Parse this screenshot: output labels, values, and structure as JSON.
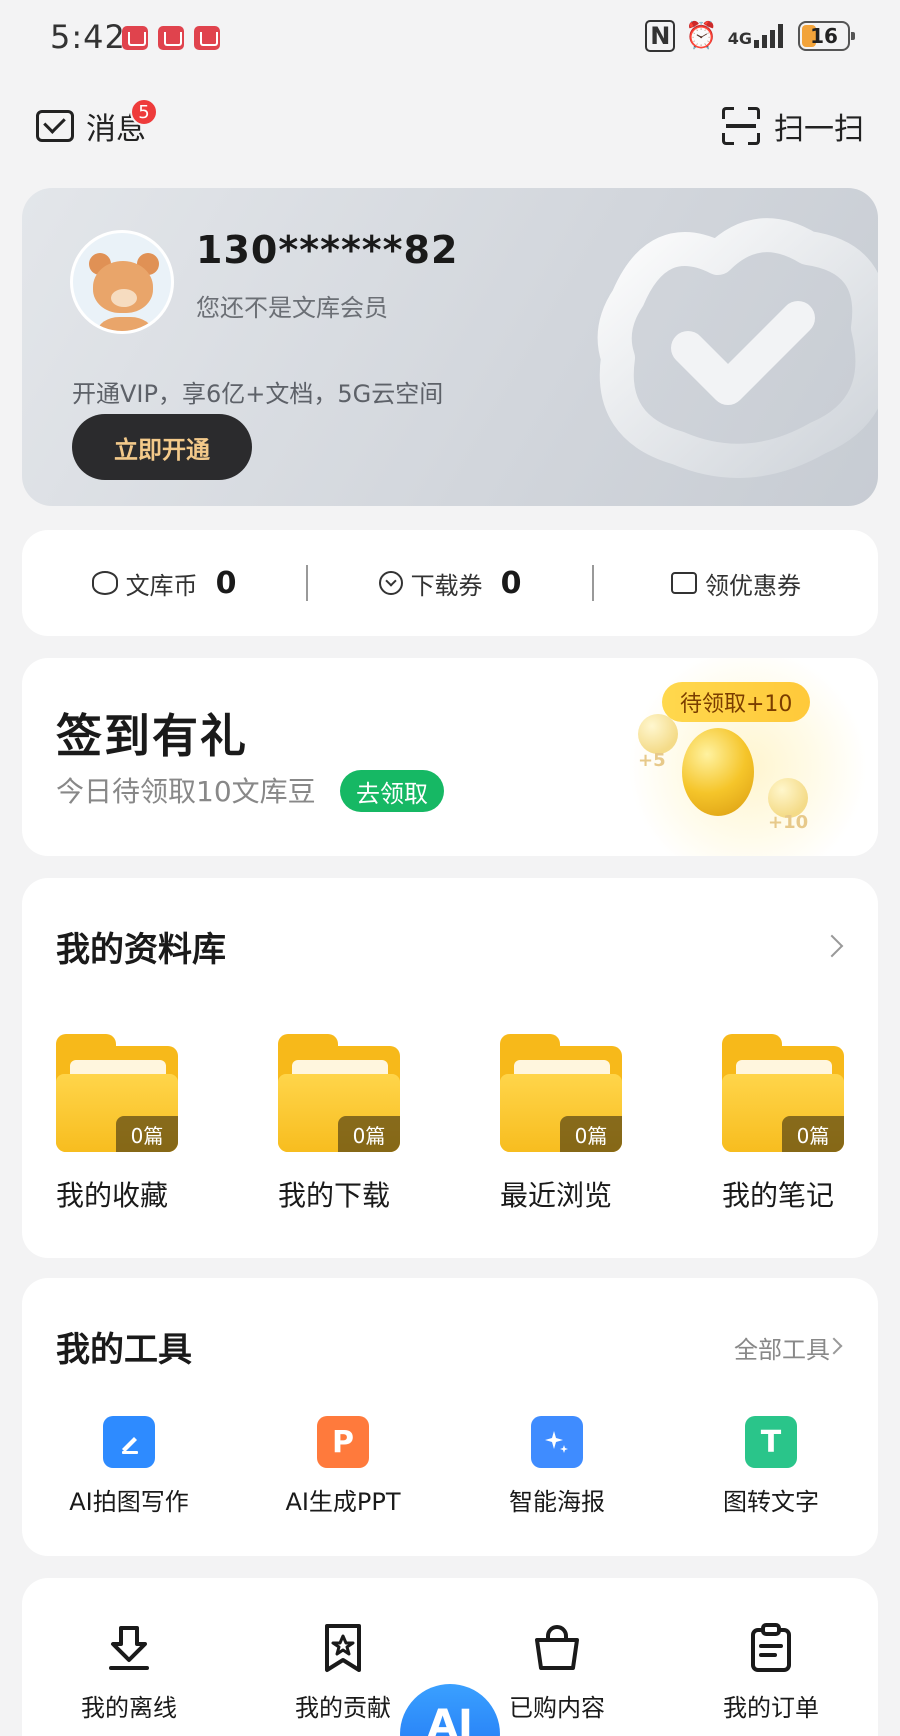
{
  "status_bar": {
    "time": "5:42",
    "network": "4G",
    "battery": "16"
  },
  "header": {
    "messages_label": "消息",
    "messages_badge": "5",
    "scan_label": "扫一扫"
  },
  "profile": {
    "username": "130******82",
    "member_status": "您还不是文库会员",
    "vip_promo": "开通VIP，享6亿+文档，5G云空间",
    "open_button": "立即开通"
  },
  "stats": {
    "coins_label": "文库币",
    "coins_value": "0",
    "tickets_label": "下载券",
    "tickets_value": "0",
    "coupon_label": "领优惠券"
  },
  "signin": {
    "title": "签到有礼",
    "subtitle": "今日待领取10文库豆",
    "claim_button": "去领取",
    "pending_label": "待领取+10",
    "bonus_small": "+5",
    "bonus_large": "+10"
  },
  "library": {
    "title": "我的资料库",
    "folders": [
      {
        "label": "我的收藏",
        "count": "0篇"
      },
      {
        "label": "我的下载",
        "count": "0篇"
      },
      {
        "label": "最近浏览",
        "count": "0篇"
      },
      {
        "label": "我的笔记",
        "count": "0篇"
      }
    ]
  },
  "tools": {
    "title": "我的工具",
    "all_tools_label": "全部工具",
    "items": [
      {
        "label": "AI拍图写作",
        "icon": "photo-write-icon",
        "color": "#2e8bff"
      },
      {
        "label": "AI生成PPT",
        "icon": "ppt-icon",
        "color": "#ff7a3c"
      },
      {
        "label": "智能海报",
        "icon": "poster-icon",
        "color": "#3f8cff"
      },
      {
        "label": "图转文字",
        "icon": "image-to-text-icon",
        "color": "#2ac58a"
      }
    ]
  },
  "bottom": {
    "items": [
      {
        "label": "我的离线",
        "icon": "offline-download-icon"
      },
      {
        "label": "我的贡献",
        "icon": "contribution-icon"
      },
      {
        "label": "已购内容",
        "icon": "purchased-bag-icon"
      },
      {
        "label": "我的订单",
        "icon": "order-clipboard-icon"
      }
    ],
    "ai_button": "AI"
  }
}
